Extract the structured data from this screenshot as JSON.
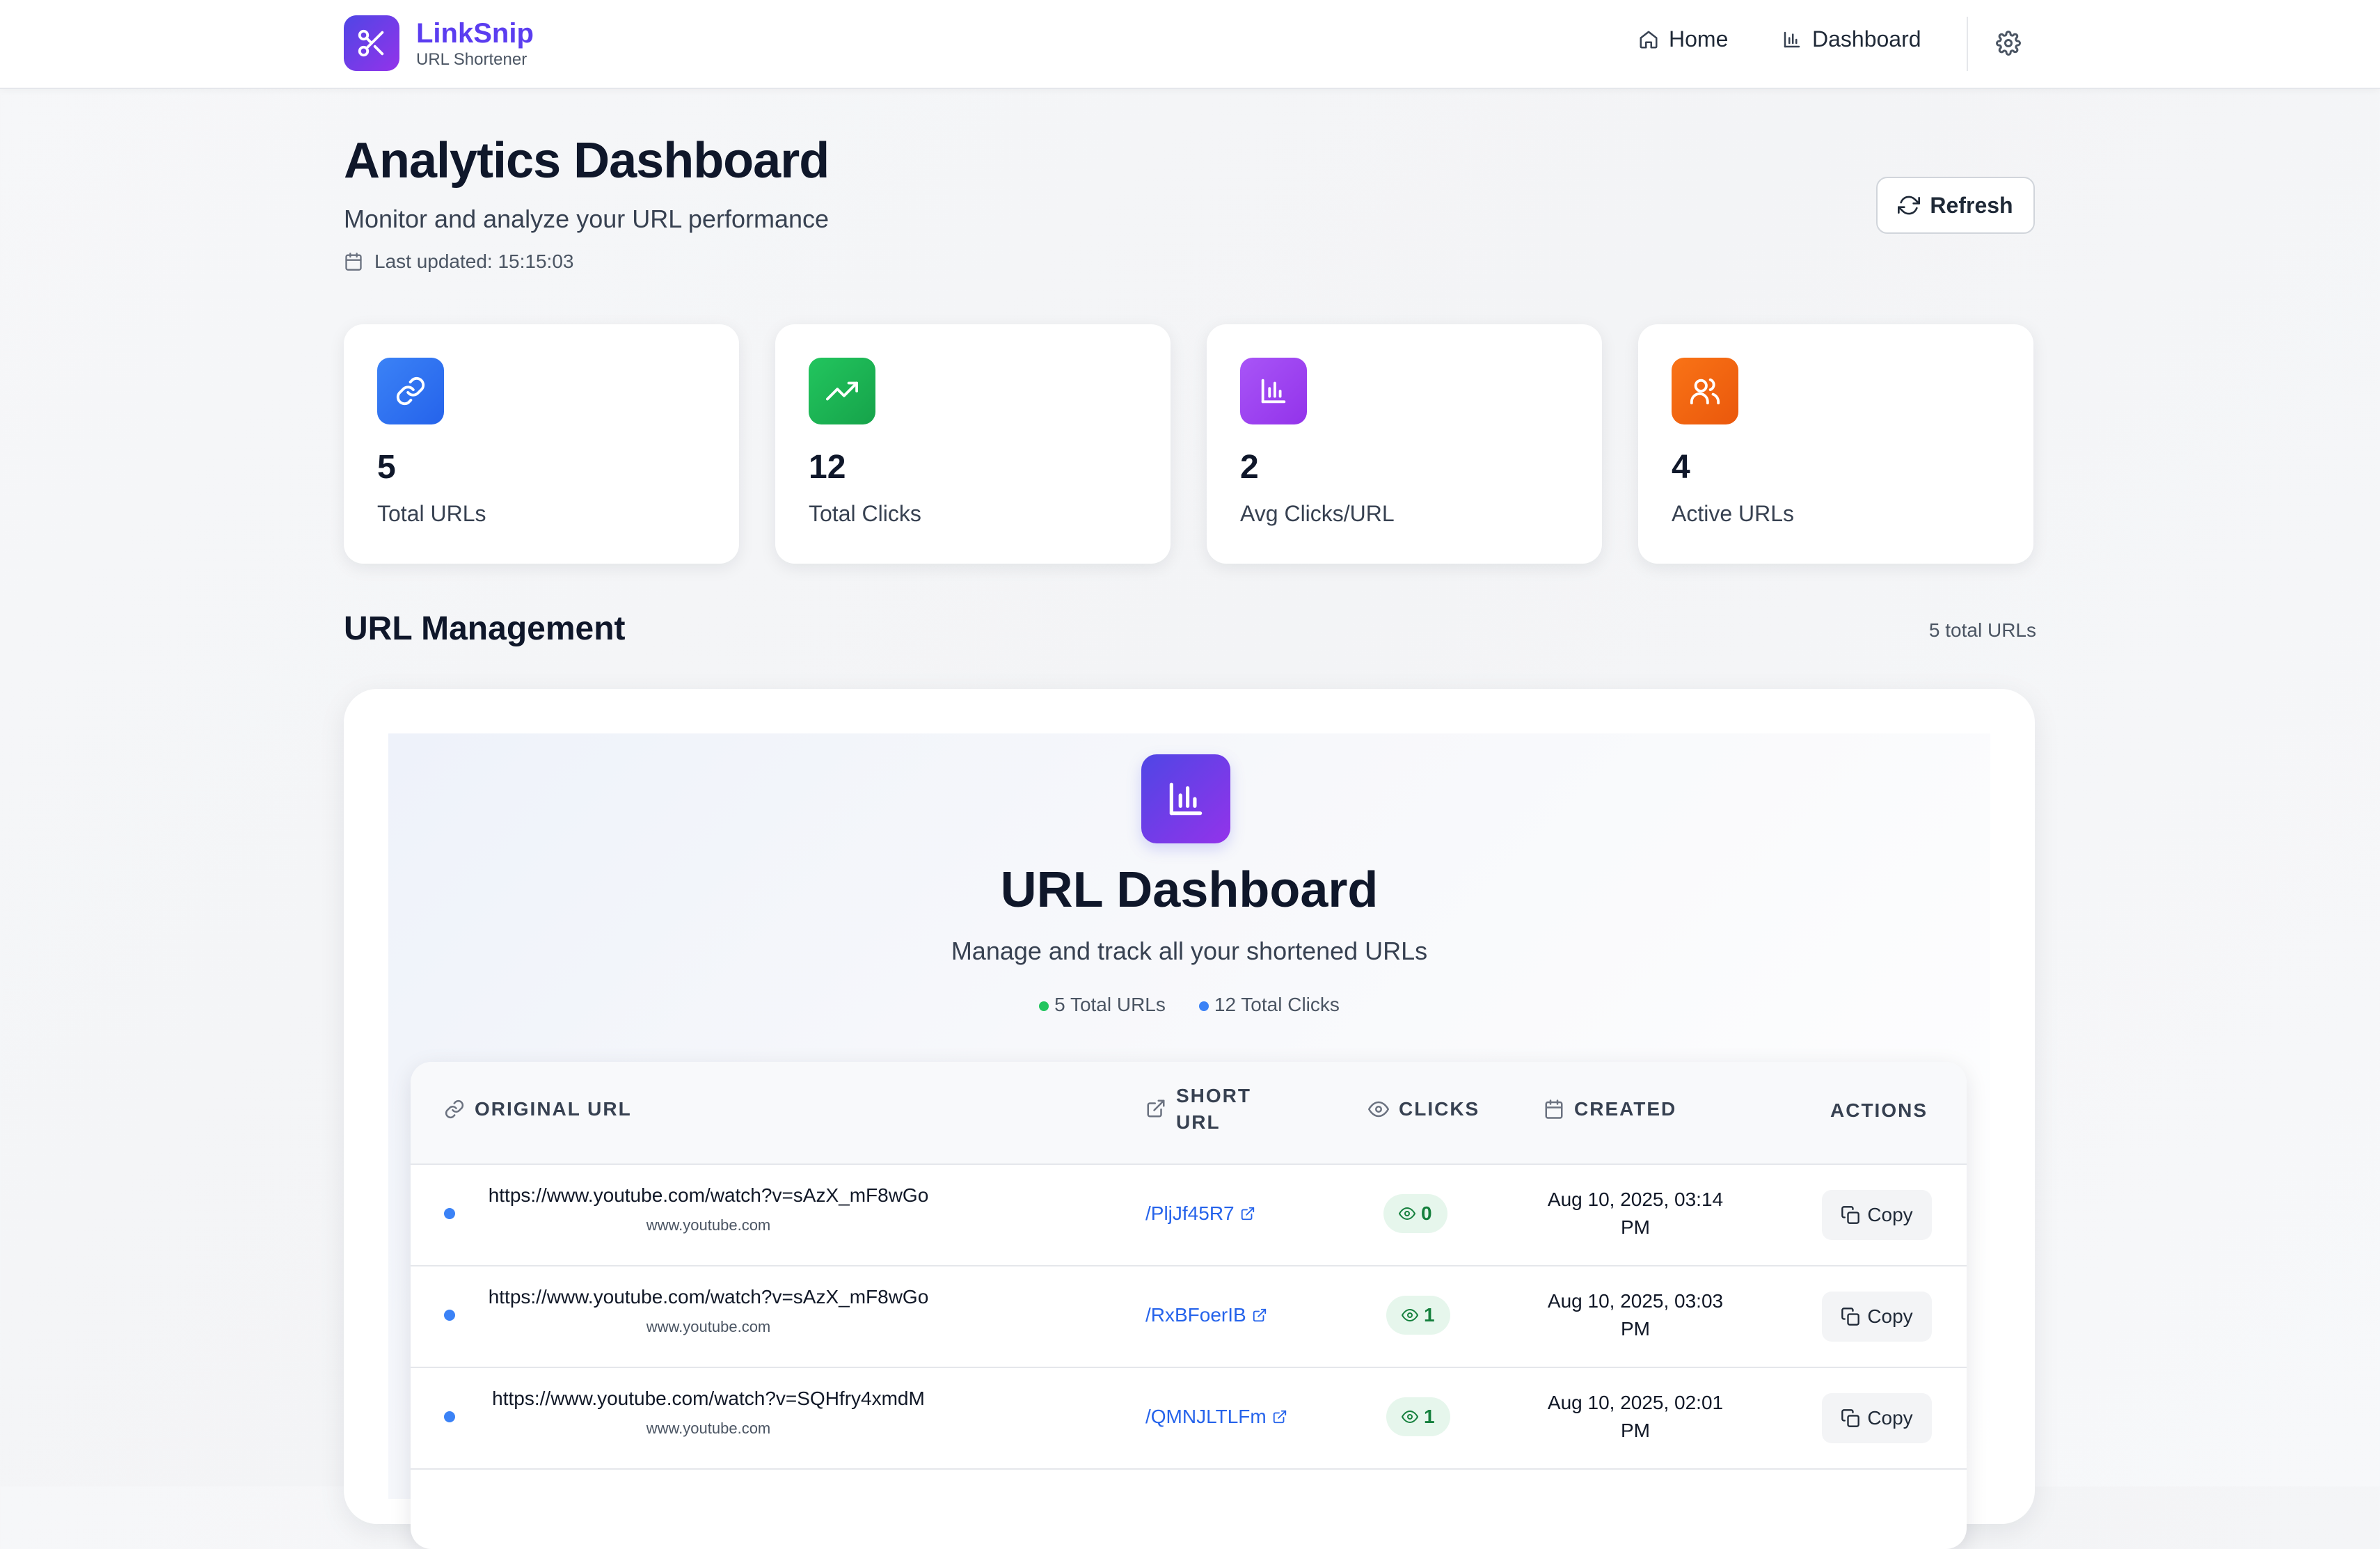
{
  "app": {
    "name": "LinkSnip",
    "subtitle": "URL Shortener"
  },
  "nav": {
    "home": "Home",
    "dashboard": "Dashboard"
  },
  "header": {
    "title": "Analytics Dashboard",
    "subtitle": "Monitor and analyze your URL performance",
    "last_updated": "Last updated: 15:15:03",
    "refresh_label": "Refresh"
  },
  "stats": [
    {
      "value": "5",
      "label": "Total URLs",
      "color": "#3b82f6",
      "icon": "link-icon"
    },
    {
      "value": "12",
      "label": "Total Clicks",
      "color": "#22c55e",
      "icon": "trending-up-icon"
    },
    {
      "value": "2",
      "label": "Avg Clicks/URL",
      "color": "#a855f7",
      "icon": "bar-chart-icon"
    },
    {
      "value": "4",
      "label": "Active URLs",
      "color": "#f97316",
      "icon": "users-icon"
    }
  ],
  "section": {
    "title": "URL Management",
    "count": "5 total URLs"
  },
  "dashboard": {
    "title": "URL Dashboard",
    "subtitle": "Manage and track all your shortened URLs",
    "badge_urls": "5 Total URLs",
    "badge_clicks": "12 Total Clicks"
  },
  "table": {
    "headers": {
      "original": "ORIGINAL URL",
      "short_line1": "SHORT",
      "short_line2": "URL",
      "clicks": "CLICKS",
      "created": "CREATED",
      "actions": "ACTIONS"
    },
    "rows": [
      {
        "url": "https://www.youtube.com/watch?v=sAzX_mF8wGo",
        "host": "www.youtube.com",
        "short": "/PljJf45R7",
        "clicks": "0",
        "created_line1": "Aug 10, 2025, 03:14",
        "created_line2": "PM",
        "action": "Copy"
      },
      {
        "url": "https://www.youtube.com/watch?v=sAzX_mF8wGo",
        "host": "www.youtube.com",
        "short": "/RxBFoerIB",
        "clicks": "1",
        "created_line1": "Aug 10, 2025, 03:03",
        "created_line2": "PM",
        "action": "Copy"
      },
      {
        "url": "https://www.youtube.com/watch?v=SQHfry4xmdM",
        "host": "www.youtube.com",
        "short": "/QMNJLTLFm",
        "clicks": "1",
        "created_line1": "Aug 10, 2025, 02:01",
        "created_line2": "PM",
        "action": "Copy"
      }
    ]
  }
}
